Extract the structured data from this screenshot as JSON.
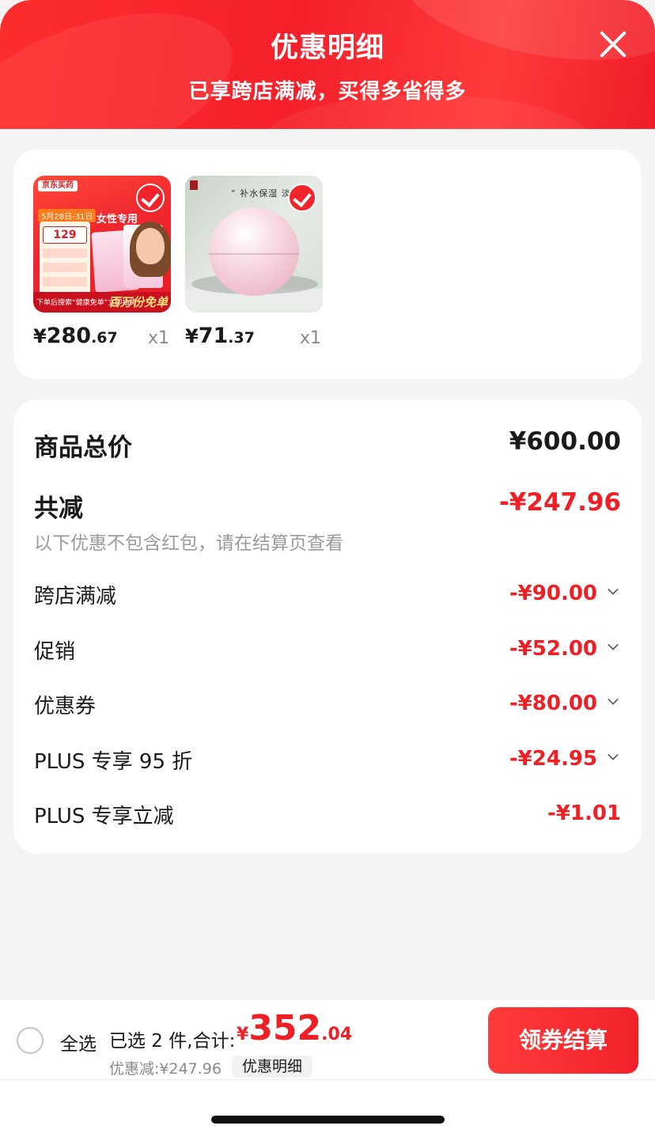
{
  "header": {
    "title": "优惠明细",
    "subtitle": "已享跨店满减，买得多省得多"
  },
  "products": [
    {
      "price_symbol": "¥",
      "price_int": "280",
      "price_dec": ".67",
      "qty": "x1",
      "thumb": {
        "logo": "京东买药",
        "banner": "女性专用",
        "date": "5月28日-31日",
        "big_price": "129",
        "footer_text": "下单后搜索“健康免单”立即抽奖",
        "footer_badge": "百万份免单"
      }
    },
    {
      "price_symbol": "¥",
      "price_int": "71",
      "price_dec": ".37",
      "qty": "x1",
      "thumb": {
        "slogan": "“ 补水保湿 淡化黑"
      }
    }
  ],
  "summary": {
    "total_label": "商品总价",
    "total_value": "¥600.00",
    "reduce_label": "共减",
    "reduce_value": "-¥247.96",
    "reduce_note": "以下优惠不包含红包，请在结算页查看",
    "items": [
      {
        "label": "跨店满减",
        "value": "-¥90.00"
      },
      {
        "label": "促销",
        "value": "-¥52.00"
      },
      {
        "label": "优惠券",
        "value": "-¥80.00"
      },
      {
        "label": "PLUS 专享 95 折",
        "value": "-¥24.95"
      },
      {
        "label": "PLUS 专享立减",
        "value": "-¥1.01"
      }
    ]
  },
  "bottom_bar": {
    "select_all": "全选",
    "selected_text": "已选 2 件,合计:",
    "total_symbol": "¥",
    "total_int": "352",
    "total_dec": ".04",
    "discount_text": "优惠减:¥247.96",
    "detail_button": "优惠明细",
    "checkout_button": "领券结算"
  },
  "colors": {
    "brand_red": "#ee1f25",
    "header_red": "#f5202a"
  }
}
